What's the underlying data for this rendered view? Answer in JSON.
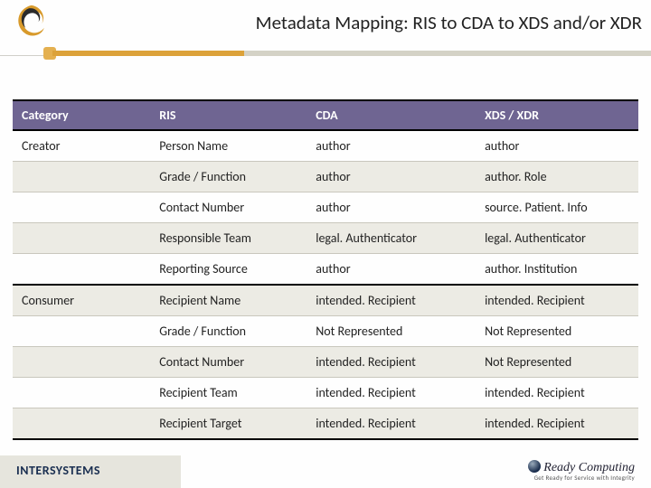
{
  "title": "Metadata Mapping:  RIS to CDA to XDS and/or XDR",
  "columns": [
    "Category",
    "RIS",
    "CDA",
    "XDS / XDR"
  ],
  "rows": [
    {
      "category": "Creator",
      "ris": "Person Name",
      "cda": "author",
      "xds": "author",
      "sep": true
    },
    {
      "category": "",
      "ris": "Grade / Function",
      "cda": "author",
      "xds": "author. Role"
    },
    {
      "category": "",
      "ris": "Contact Number",
      "cda": "author",
      "xds": "source. Patient. Info"
    },
    {
      "category": "",
      "ris": "Responsible Team",
      "cda": "legal. Authenticator",
      "xds": "legal. Authenticator"
    },
    {
      "category": "",
      "ris": "Reporting Source",
      "cda": "author",
      "xds": "author. Institution"
    },
    {
      "category": "Consumer",
      "ris": "Recipient Name",
      "cda": "intended. Recipient",
      "xds": "intended. Recipient",
      "sep": true
    },
    {
      "category": "",
      "ris": "Grade / Function",
      "cda": " Not Represented",
      "xds": " Not Represented"
    },
    {
      "category": "",
      "ris": "Contact Number",
      "cda": "intended. Recipient",
      "xds": " Not Represented"
    },
    {
      "category": "",
      "ris": "Recipient Team",
      "cda": "intended. Recipient",
      "xds": "intended. Recipient"
    },
    {
      "category": "",
      "ris": "Recipient Target",
      "cda": "intended. Recipient",
      "xds": "intended. Recipient",
      "last": true
    }
  ],
  "footer": {
    "left_brand": "INTERSYSTEMS",
    "right_brand_main": "Ready Computing",
    "right_brand_sub": "Get Ready for Service with Integrity"
  }
}
